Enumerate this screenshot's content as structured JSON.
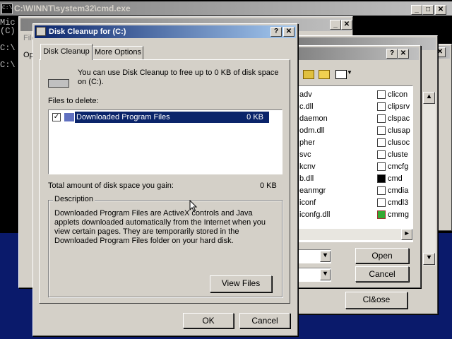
{
  "desktop": {
    "color": "#0a1a6b"
  },
  "cmd_window": {
    "title": "C:\\WINNT\\system32\\cmd.exe",
    "lines": [
      "Mic",
      "(C)",
      "",
      "C:\\",
      "",
      "C:\\"
    ]
  },
  "bg_window1": {
    "file_menu": "File",
    "label_op": "Op"
  },
  "open_dialog": {
    "files_left": [
      "adv",
      "c.dll",
      "daemon",
      "odm.dll",
      "pher",
      "svc",
      "kcnv",
      "b.dll",
      "eanmgr",
      "iconf",
      "iconfg.dll"
    ],
    "files_right": [
      "clicon",
      "clipsrv",
      "clspac",
      "clusap",
      "clusoc",
      "cluste",
      "cmcfg",
      "cmd",
      "cmdia",
      "cmdl3",
      "cmmg"
    ],
    "open_label": "Open",
    "cancel_label": "Cancel"
  },
  "close_dialog": {
    "close_label": "Cl&ose"
  },
  "disk_cleanup": {
    "title": "Disk Cleanup for  (C:)",
    "tabs": [
      "Disk Cleanup",
      "More Options"
    ],
    "intro": "You can use Disk Cleanup to free up to 0 KB of disk space on  (C:).",
    "files_to_delete_label": "Files to delete:",
    "items": [
      {
        "name": "Downloaded Program Files",
        "size": "0 KB",
        "checked": true
      }
    ],
    "total_label": "Total amount of disk space you gain:",
    "total_value": "0 KB",
    "description_label": "Description",
    "description": "Downloaded Program Files are ActiveX controls and Java applets downloaded automatically from the Internet when you view certain pages. They are temporarily stored in the Downloaded Program Files folder on your hard disk.",
    "view_files_label": "View Files",
    "ok_label": "OK",
    "cancel_label": "Cancel"
  }
}
